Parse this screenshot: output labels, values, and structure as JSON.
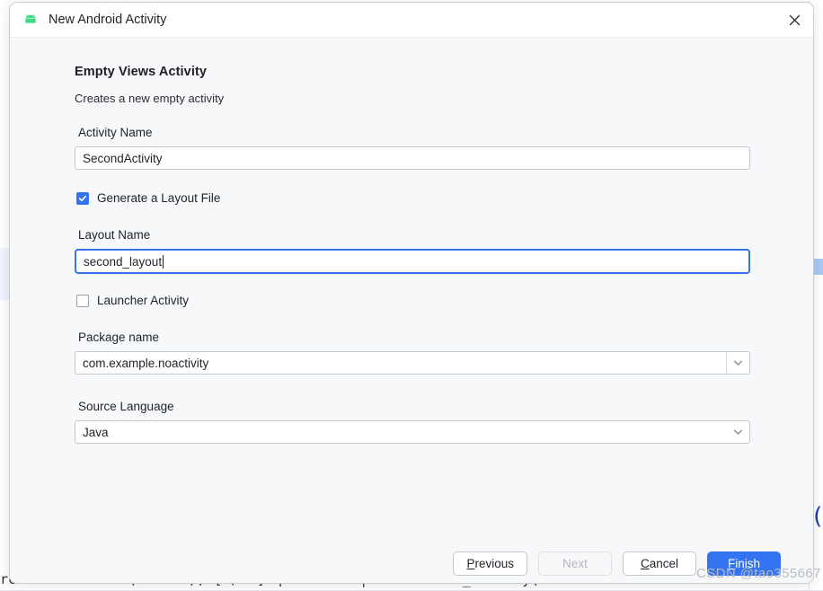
{
  "window": {
    "title": "New Android Activity",
    "app_icon": "android-icon",
    "close_icon": "close-icon"
  },
  "form": {
    "heading": "Empty Views Activity",
    "description": "Creates a new empty activity",
    "activity_name": {
      "label": "Activity Name",
      "value": "SecondActivity"
    },
    "generate_layout": {
      "label": "Generate a Layout File",
      "checked": "true"
    },
    "layout_name": {
      "label": "Layout Name",
      "value": "second_layout",
      "focused": "true"
    },
    "launcher_activity": {
      "label": "Launcher Activity",
      "checked": "false"
    },
    "package_name": {
      "label": "Package name",
      "value": "com.example.noactivity",
      "dropdown_icon": "chevron-down-icon"
    },
    "source_language": {
      "label": "Source Language",
      "value": "Java",
      "dropdown_icon": "chevron-down-icon"
    }
  },
  "footer": {
    "previous": {
      "prefix": "",
      "mnemonic": "P",
      "suffix": "revious"
    },
    "next": {
      "label": "Next"
    },
    "cancel": {
      "prefix": "",
      "mnemonic": "C",
      "suffix": "ancel"
    },
    "finish": {
      "prefix": "",
      "mnemonic": "F",
      "suffix": "inish"
    }
  },
  "watermark": "CSDN @tao355667",
  "background": {
    "code_line": "reasonableToast(  this  );  [V/mm] q Collect | reasonable_shortly(  h"
  },
  "colors": {
    "accent": "#3574f0",
    "dialog_bg": "#f7f8fa",
    "titlebar_bg": "#ffffff",
    "border": "#c4c7ce",
    "android_green": "#3ddc84",
    "disabled_text": "#b3b6bd"
  }
}
